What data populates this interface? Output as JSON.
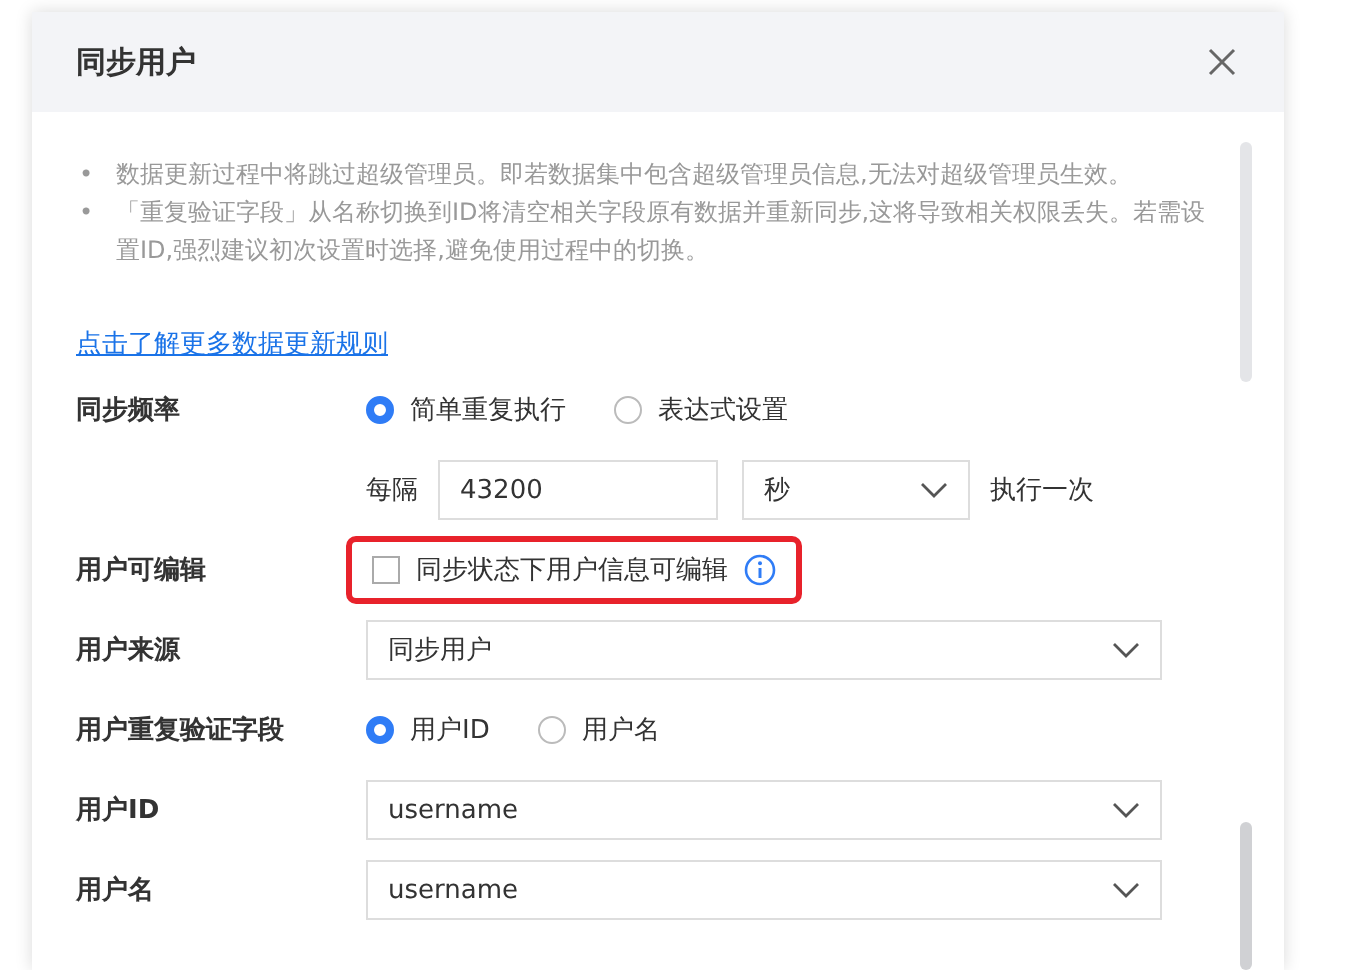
{
  "dialog": {
    "title": "同步用户"
  },
  "notes": [
    {
      "marker": "•",
      "text": "数据更新过程中将跳过超级管理员。即若数据集中包含超级管理员信息,无法对超级管理员生效。"
    },
    {
      "marker": "•",
      "text": "「重复验证字段」从名称切换到ID将清空相关字段原有数据并重新同步,这将导致相关权限丢失。若需设置ID,强烈建议初次设置时选择,避免使用过程中的切换。"
    }
  ],
  "link": "点击了解更多数据更新规则",
  "rows": [
    {
      "kind": "radio",
      "label": "同步频率",
      "options": [
        {
          "label": "简单重复执行",
          "selected": true
        },
        {
          "label": "表达式设置",
          "selected": false
        }
      ]
    },
    {
      "kind": "interval",
      "prefix": "每隔",
      "value": "43200",
      "unit": "秒",
      "suffix": "执行一次"
    },
    {
      "kind": "checkbox",
      "label": "用户可编辑",
      "text": "同步状态下用户信息可编辑",
      "checked": false,
      "highlighted": true
    },
    {
      "kind": "select",
      "label": "用户来源",
      "value": "同步用户"
    },
    {
      "kind": "radio",
      "label": "用户重复验证字段",
      "options": [
        {
          "label": "用户ID",
          "selected": true
        },
        {
          "label": "用户名",
          "selected": false
        }
      ]
    },
    {
      "kind": "select",
      "label": "用户ID",
      "value": "username"
    },
    {
      "kind": "select",
      "label": "用户名",
      "value": "username"
    }
  ]
}
